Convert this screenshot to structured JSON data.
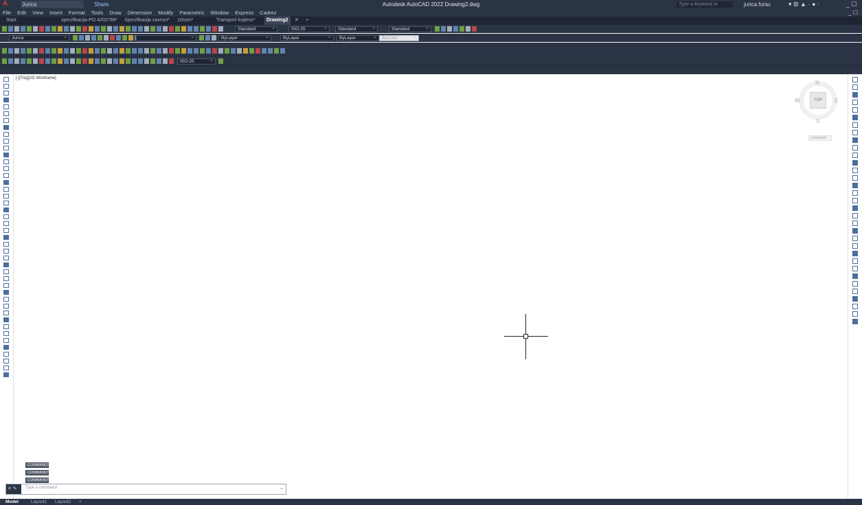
{
  "titlebar": {
    "workspace": "Jurica",
    "share": "Share",
    "title": "Autodesk AutoCAD 2022  Drawing2.dwg",
    "search_placeholder": "Type a keyword or phrase",
    "user": "jurica.furac"
  },
  "menu": [
    "File",
    "Edit",
    "View",
    "Insert",
    "Format",
    "Tools",
    "Draw",
    "Dimension",
    "Modify",
    "Parametric",
    "Window",
    "Express",
    "Cadrez"
  ],
  "file_tabs": [
    {
      "label": "Start",
      "active": false
    },
    {
      "label": "specifikacija-PO 4202788*",
      "active": false
    },
    {
      "label": "Specifikacija zavrsni*",
      "active": false
    },
    {
      "label": "10ssm*",
      "active": false
    },
    {
      "label": "Transport kojieno*",
      "active": false
    },
    {
      "label": "Drawing2",
      "active": true
    }
  ],
  "toolbar1": {
    "text_style": "Standard",
    "dim_style": "ISO-25",
    "table_style": "Standard",
    "multileader_style": "Standard"
  },
  "toolbar2": {
    "layer": "Jurica",
    "color": "ByLayer",
    "linetype": "ByLayer",
    "lineweight": "ByLayer",
    "plotstyle": "ByColor"
  },
  "toolbar4": {
    "dim_style": "ISO-25"
  },
  "viewport": {
    "label": "[-][Top][2D Wireframe]"
  },
  "viewcube": {
    "top": "TOP",
    "north": "N",
    "south": "S",
    "east": "E",
    "west": "W",
    "ucs": "Unnamed"
  },
  "command": {
    "history": [
      "COMMANDS",
      "COMMANDS",
      "COMMANDS"
    ],
    "placeholder": "Type a command"
  },
  "layout_tabs": [
    {
      "label": "Model",
      "active": true
    },
    {
      "label": "Layout1",
      "active": false
    },
    {
      "label": "Layout2",
      "active": false
    },
    {
      "label": "+",
      "active": false
    }
  ]
}
